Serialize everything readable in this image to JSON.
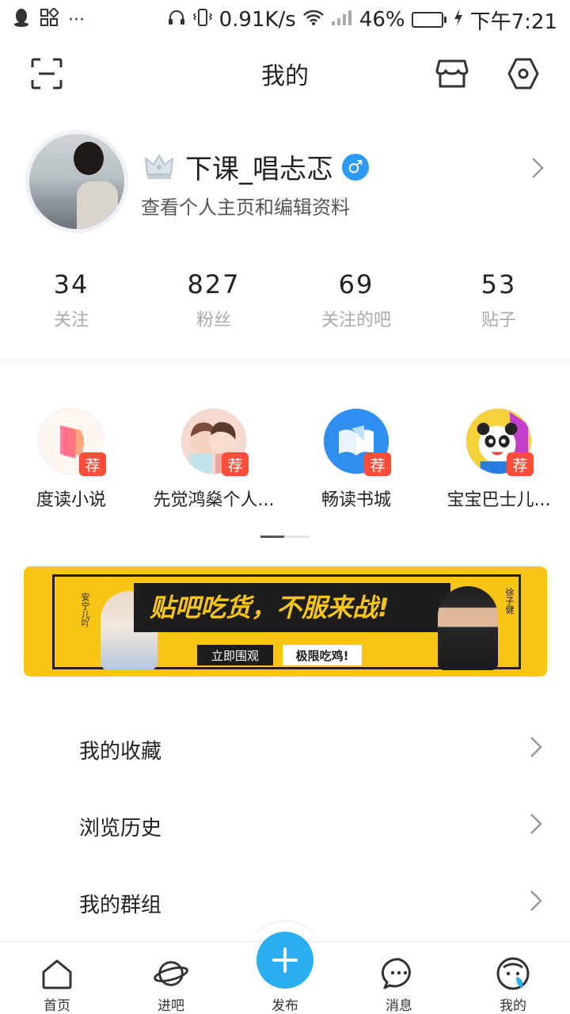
{
  "status_bar": {
    "left_icons": [
      "qq-icon",
      "apps-icon",
      "more-icon"
    ],
    "more": "···",
    "network_speed": "0.91K/s",
    "battery_percent": "46%",
    "battery_level": 0.46,
    "time": "下午7:21"
  },
  "header": {
    "title": "我的"
  },
  "profile": {
    "username": "下课_唱忐忑",
    "subtitle": "查看个人主页和编辑资料",
    "gender_symbol": "♂"
  },
  "stats": [
    {
      "value": "34",
      "label": "关注"
    },
    {
      "value": "827",
      "label": "粉丝"
    },
    {
      "value": "69",
      "label": "关注的吧"
    },
    {
      "value": "53",
      "label": "贴子"
    }
  ],
  "apps": [
    {
      "label": "度读小说",
      "badge": "荐",
      "icon": "book-app-icon"
    },
    {
      "label": "先觉鸿燊个人...",
      "badge": "荐",
      "icon": "couple-app-icon"
    },
    {
      "label": "畅读书城",
      "badge": "荐",
      "icon": "open-book-app-icon"
    },
    {
      "label": "宝宝巴士儿...",
      "badge": "荐",
      "icon": "panda-app-icon"
    }
  ],
  "banner": {
    "headline": "贴吧吃货，不服来战!",
    "left_name": "安宁儿吖",
    "right_name": "徐子健",
    "button1": "立即围观",
    "button2": "极限吃鸡!"
  },
  "menu": [
    {
      "label": "我的收藏"
    },
    {
      "label": "浏览历史"
    },
    {
      "label": "我的群组"
    }
  ],
  "bottom_nav": [
    {
      "label": "首页",
      "icon": "home-icon"
    },
    {
      "label": "进吧",
      "icon": "planet-icon"
    },
    {
      "label": "发布",
      "icon": "plus-icon"
    },
    {
      "label": "消息",
      "icon": "message-icon"
    },
    {
      "label": "我的",
      "icon": "profile-icon"
    }
  ],
  "colors": {
    "accent": "#2aaef0",
    "badge": "#ff4d3a",
    "banner_yellow": "#f8c514",
    "battery_green": "#35c759"
  }
}
